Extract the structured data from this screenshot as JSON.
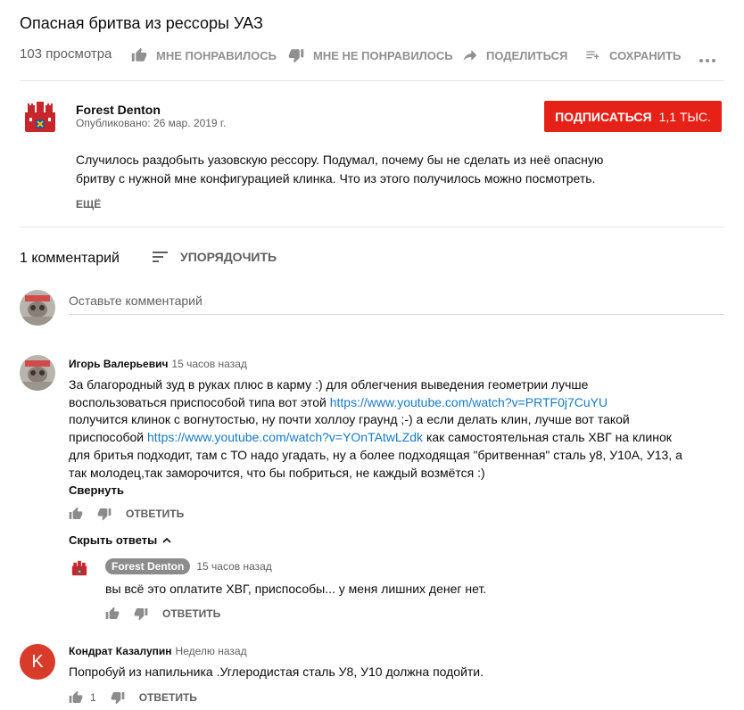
{
  "video": {
    "title": "Опасная бритва из рессоры УАЗ",
    "views": "103 просмотра",
    "like_label": "МНЕ ПОНРАВИЛОСЬ",
    "dislike_label": "МНЕ НЕ ПОНРАВИЛОСЬ",
    "share_label": "ПОДЕЛИТЬСЯ",
    "save_label": "СОХРАНИТЬ"
  },
  "channel": {
    "name": "Forest Denton",
    "published": "Опубликовано: 26 мар. 2019 г.",
    "subscribe_label": "ПОДПИСАТЬСЯ",
    "subscriber_count": "1,1 ТЫС."
  },
  "description": {
    "line1": "Случилось раздобыть уазовскую рессору. Подумал, почему бы не сделать из неё опасную",
    "line2": "бритву с нужной мне конфигурацией клинка. Что из этого получилось можно посмотреть.",
    "more_label": "ЕЩЁ"
  },
  "comments_header": {
    "count": "1 комментарий",
    "sort_label": "УПОРЯДОЧИТЬ",
    "input_placeholder": "Оставьте комментарий"
  },
  "comments": [
    {
      "author": "Игорь Валерьевич",
      "time": "15 часов назад",
      "text_parts": {
        "l1": "За благородный зуд в руках плюс в карму :) для облегчения выведения геометрии лучше",
        "l2a": "воспользоваться приспособой типа вот этой ",
        "link1": "https://www.youtube.com/watch?v=PRTF0j7CuYU",
        "l3": " получится клинок с вогнутостью, ну почти холлоу граунд ;-) а если делать клин, лучше вот такой",
        "l4a": "приспособой ",
        "link2": "https://www.youtube.com/watch?v=YOnTAtwLZdk",
        "l4b": " как самостоятельная сталь ХВГ на клинок",
        "l5": "для бритья подходит, там с ТО надо угадать, ну а более подходящая \"бритвенная\" сталь у8, У10А, У13, а",
        "l6": "так молодец,так заморочится, что бы побриться, не каждый возмётся :)"
      },
      "collapse_label": "Свернуть",
      "reply_label": "ОТВЕТИТЬ",
      "hide_replies_label": "Скрыть ответы",
      "replies": [
        {
          "author": "Forest Denton",
          "time": "15 часов назад",
          "text": "вы всё это оплатите ХВГ, приспособы... у меня лишних денег нет.",
          "reply_label": "ОТВЕТИТЬ"
        }
      ]
    },
    {
      "author": "Кондрат Казалупин",
      "time": "Неделю назад",
      "avatar_letter": "K",
      "text": "Попробуй из напильника .Углеродистая сталь У8, У10 должна подойти.",
      "likes": "1",
      "reply_label": "ОТВЕТИТЬ"
    }
  ],
  "colors": {
    "subscribe_red": "#e62117",
    "link_blue": "#167ac6",
    "k_avatar": "#d93b2b"
  }
}
